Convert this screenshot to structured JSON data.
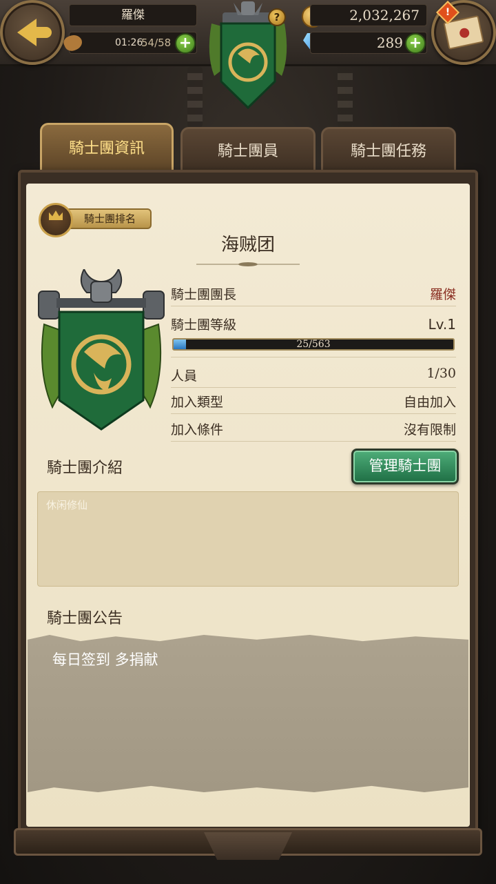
{
  "header": {
    "player_name": "羅傑",
    "stamina_timer": "01:26",
    "stamina_value": "54/58",
    "stamina_add": "+",
    "gold": "2,032,267",
    "gems": "289",
    "gem_add": "+",
    "help_label": "?",
    "mail_alert": "!"
  },
  "tabs": [
    {
      "label": "騎士團資訊",
      "active": true
    },
    {
      "label": "騎士團員",
      "active": false
    },
    {
      "label": "騎士團任務",
      "active": false
    }
  ],
  "guild": {
    "rank_label": "騎士團排名",
    "name": "海贼团",
    "rows": {
      "leader": {
        "label": "騎士團團長",
        "value": "羅傑"
      },
      "level": {
        "label": "騎士團等級",
        "value": "Lv.1",
        "exp_text": "25/563",
        "exp_fraction": 0.044
      },
      "members": {
        "label": "人員",
        "value": "1/30"
      },
      "join_type": {
        "label": "加入類型",
        "value": "自由加入"
      },
      "join_condition": {
        "label": "加入條件",
        "value": "沒有限制"
      }
    },
    "intro_title": "騎士團介紹",
    "manage_button": "管理騎士團",
    "intro_text": "休闲修仙",
    "notice_title": "騎士團公告",
    "notice_text": "每日签到 多捐献"
  },
  "colors": {
    "banner_green": "#1f6b3a",
    "crest_gold": "#d9b45a",
    "accent_gold": "#ffe08a",
    "leader_name": "#8a2e22",
    "manage_button": "#2e8a58"
  },
  "icons": [
    "back-arrow-icon",
    "mail-icon",
    "stamina-icon",
    "coin-icon",
    "gem-icon",
    "help-icon",
    "lion-crest-icon",
    "rank-crown-icon"
  ]
}
